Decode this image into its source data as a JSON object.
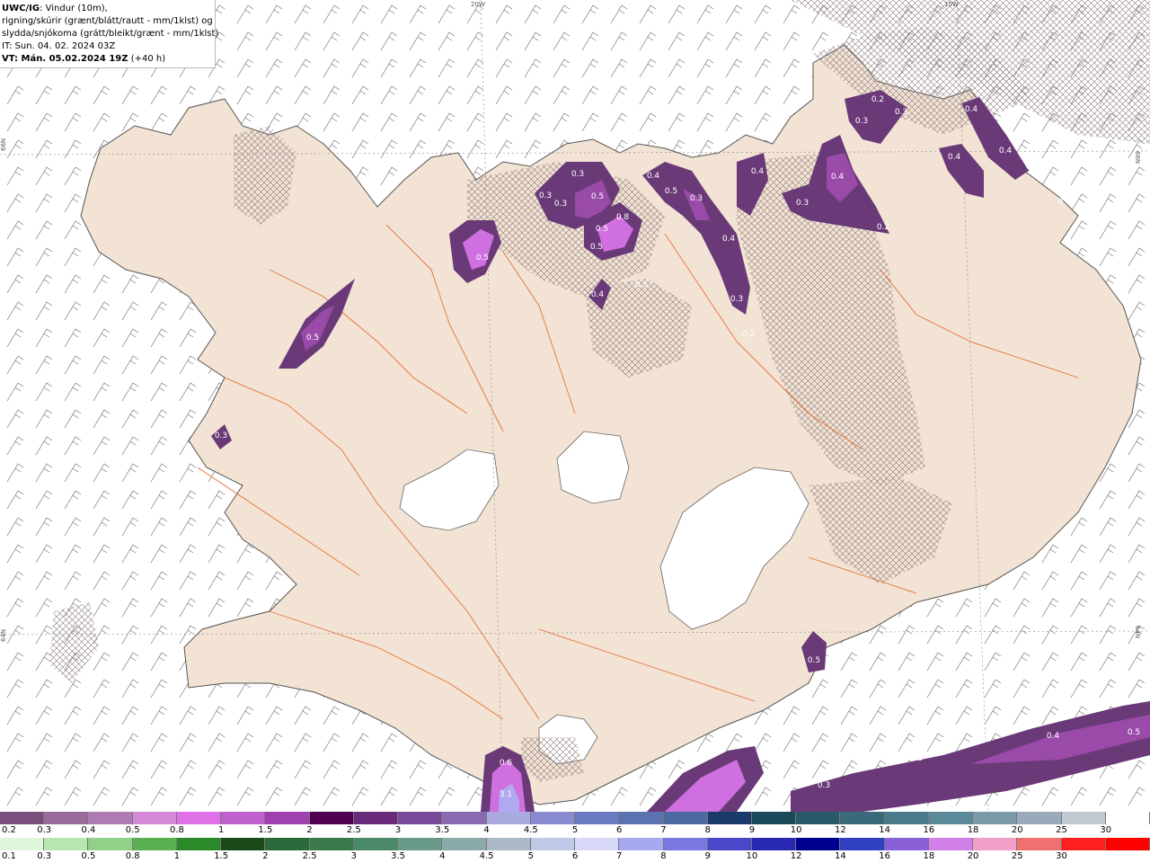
{
  "header": {
    "line1_bold": "UWC/IG",
    "line1_rest": ": Vindur (10m),",
    "line2": "rigning/skúrir (grænt/blátt/rautt - mm/1klst) og",
    "line3": "slydda/snjókoma (grátt/bleikt/grænt - mm/1klst)",
    "line4": "IT: Sun. 04. 02. 2024 03Z",
    "line5_bold": "VT: Mán. 05.02.2024 19Z",
    "line5_rest": " (+40 h)"
  },
  "graticule_labels": {
    "top_20w": "20W",
    "top_15w": "15W",
    "left_66n": "66N",
    "right_66n": "66N",
    "left_64n": "64N",
    "right_64n": "64N"
  },
  "precip_labels": [
    "0.2",
    "0.3",
    "0.3",
    "0.4",
    "0.4",
    "0.4",
    "0.3",
    "0.3",
    "0.5",
    "0.3",
    "0.5",
    "0.5",
    "0.8",
    "0.5",
    "0.4",
    "0.3",
    "0.5",
    "0.4",
    "0.4",
    "0.4",
    "0.4",
    "0.3",
    "0.2",
    "0.4",
    "0.3",
    "0.2",
    "0.5",
    "0.5",
    "0.3",
    "0.3",
    "0.5",
    "0.6",
    "3.1",
    "0.4",
    "0.5",
    "0.3",
    "0.3"
  ],
  "legend_snow": {
    "labels": [
      "0.2",
      "0.3",
      "0.4",
      "0.5",
      "0.8",
      "1",
      "1.5",
      "2",
      "2.5",
      "3",
      "3.5",
      "4",
      "4.5",
      "5",
      "6",
      "7",
      "8",
      "9",
      "10",
      "12",
      "14",
      "16",
      "18",
      "20",
      "25",
      "30"
    ],
    "colors": [
      "#7a4e7c",
      "#9a6a9c",
      "#b07ab4",
      "#d48ad8",
      "#e070e8",
      "#c060cc",
      "#a040b0",
      "#500050",
      "#6a2a7a",
      "#7a4a9a",
      "#8a6ab0",
      "#aaaae0",
      "#8a8ad0",
      "#6a7ac0",
      "#5a72b0",
      "#4a6aa0",
      "#1a3a6a",
      "#1a4a5a",
      "#2a5a6a",
      "#3a6a7a",
      "#4a7a8a",
      "#5a8a9a",
      "#7a9aaa",
      "#9aaaba",
      "#c0cad0",
      "#ffffff"
    ]
  },
  "legend_rain": {
    "labels": [
      "0.1",
      "0.3",
      "0.5",
      "0.8",
      "1",
      "1.5",
      "2",
      "2.5",
      "3",
      "3.5",
      "4",
      "4.5",
      "5",
      "6",
      "7",
      "8",
      "9",
      "10",
      "12",
      "14",
      "16",
      "18",
      "20",
      "25",
      "30"
    ],
    "colors": [
      "#dff5dc",
      "#b8e6b0",
      "#90d088",
      "#5ab050",
      "#2a8a2a",
      "#1a4a1a",
      "#2a6a3a",
      "#3a7a4a",
      "#4a8a6a",
      "#6a9a8a",
      "#8aaaa8",
      "#aab8c8",
      "#c0c8e8",
      "#d8d8f8",
      "#a8a8f0",
      "#7878e0",
      "#4848c8",
      "#2828b0",
      "#000090",
      "#3040c0",
      "#8a60d8",
      "#d080e8",
      "#f0a0c8",
      "#f07070",
      "#ff2020",
      "#ff0000"
    ]
  },
  "colors": {
    "land": "#f2e3d4",
    "sea": "#ffffff",
    "roads": "#e8703a",
    "hatch": "#8a7a7a",
    "barbs": "#555555",
    "precip_dark": "#6a3a78",
    "precip_mid": "#9a4aa8",
    "precip_bright": "#d070e0",
    "precip_core": "#b0a8f0"
  }
}
